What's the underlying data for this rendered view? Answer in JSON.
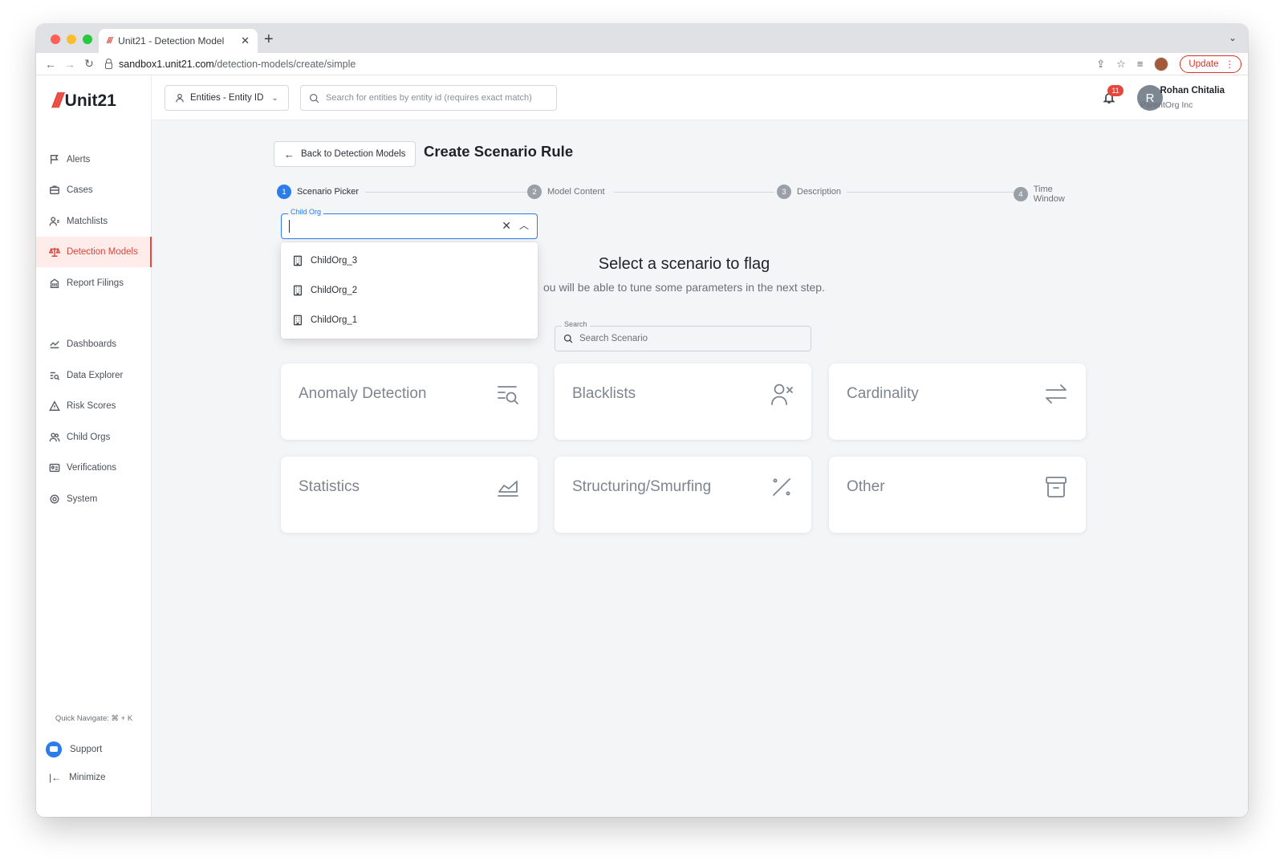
{
  "browser": {
    "tab_title": "Unit21 - Detection Model",
    "url_host": "sandbox1.unit21.com",
    "url_path": "/detection-models/create/simple",
    "update_label": "Update"
  },
  "brand": {
    "mark": "///",
    "name": "Unit21"
  },
  "sidebar": {
    "items": [
      {
        "label": "Alerts",
        "icon": "flag-icon"
      },
      {
        "label": "Cases",
        "icon": "briefcase-icon"
      },
      {
        "label": "Matchlists",
        "icon": "user-list-icon"
      },
      {
        "label": "Detection Models",
        "icon": "scale-icon",
        "active": true
      },
      {
        "label": "Report Filings",
        "icon": "building-icon"
      },
      {
        "label": "Dashboards",
        "icon": "chart-icon"
      },
      {
        "label": "Data Explorer",
        "icon": "data-search-icon"
      },
      {
        "label": "Risk Scores",
        "icon": "warning-icon"
      },
      {
        "label": "Child Orgs",
        "icon": "users-icon"
      },
      {
        "label": "Verifications",
        "icon": "id-card-icon"
      },
      {
        "label": "System",
        "icon": "gear-icon"
      }
    ],
    "quick_navigate": "Quick Navigate: ⌘ + K",
    "support": "Support",
    "minimize": "Minimize"
  },
  "topbar": {
    "entity_select": "Entities - Entity ID",
    "search_placeholder": "Search for entities by entity id (requires exact match)",
    "notification_count": "11",
    "avatar_initial": "R",
    "user_name": "Rohan Chitalia",
    "user_org": "ParentOrg Inc"
  },
  "main": {
    "back_label": "Back to Detection Models",
    "title": "Create Scenario Rule",
    "steps": [
      {
        "num": "1",
        "label": "Scenario Picker",
        "active": true
      },
      {
        "num": "2",
        "label": "Model Content"
      },
      {
        "num": "3",
        "label": "Description"
      },
      {
        "num": "4",
        "label": "Time Window"
      }
    ],
    "child_org": {
      "label": "Child Org",
      "value": "",
      "options": [
        "ChildOrg_3",
        "ChildOrg_2",
        "ChildOrg_1"
      ]
    },
    "heading": "Select a scenario to flag",
    "subheading": "ou will be able to tune some parameters in the next step.",
    "search_label": "Search",
    "search_placeholder": "Search Scenario",
    "cards": [
      {
        "label": "Anomaly Detection",
        "icon": "list-search-icon"
      },
      {
        "label": "Blacklists",
        "icon": "user-x-icon"
      },
      {
        "label": "Cardinality",
        "icon": "arrows-exchange-icon"
      },
      {
        "label": "Statistics",
        "icon": "area-chart-icon"
      },
      {
        "label": "Structuring/Smurfing",
        "icon": "percent-icon"
      },
      {
        "label": "Other",
        "icon": "archive-icon"
      }
    ]
  },
  "colors": {
    "accent": "#e8453c",
    "primary": "#2b7de9"
  }
}
